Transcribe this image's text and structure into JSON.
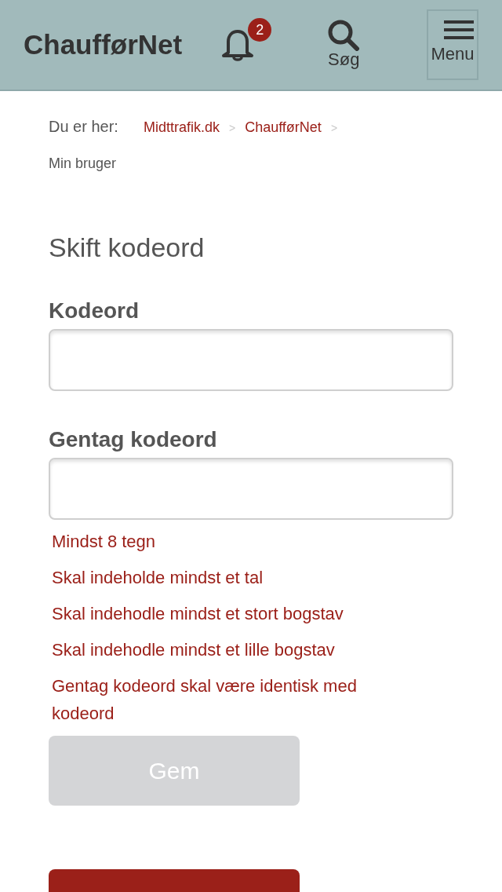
{
  "header": {
    "logo": "ChaufførNet",
    "notifications": {
      "count": "2"
    },
    "search": {
      "label": "Søg"
    },
    "menu": {
      "label": "Menu"
    }
  },
  "breadcrumb": {
    "prefix": "Du er her:",
    "items": [
      {
        "label": "Midttrafik.dk",
        "kind": "link",
        "separator": ">"
      },
      {
        "label": "ChaufførNet",
        "kind": "link",
        "separator": ">"
      },
      {
        "label": "Min bruger",
        "kind": "current"
      }
    ]
  },
  "form": {
    "title": "Skift kodeord",
    "fields": [
      {
        "label": "Kodeord"
      },
      {
        "label": "Gentag kodeord"
      }
    ],
    "errors": [
      "Mindst 8 tegn",
      "Skal indeholde mindst et tal",
      "Skal indehodle mindst et stort bogstav",
      "Skal indehodle mindst et lille bogstav",
      "Gentag kodeord skal være identisk med kodeord"
    ],
    "buttons": [
      {
        "label": "Gem",
        "disabled": true
      },
      {
        "disabled": false
      }
    ]
  }
}
